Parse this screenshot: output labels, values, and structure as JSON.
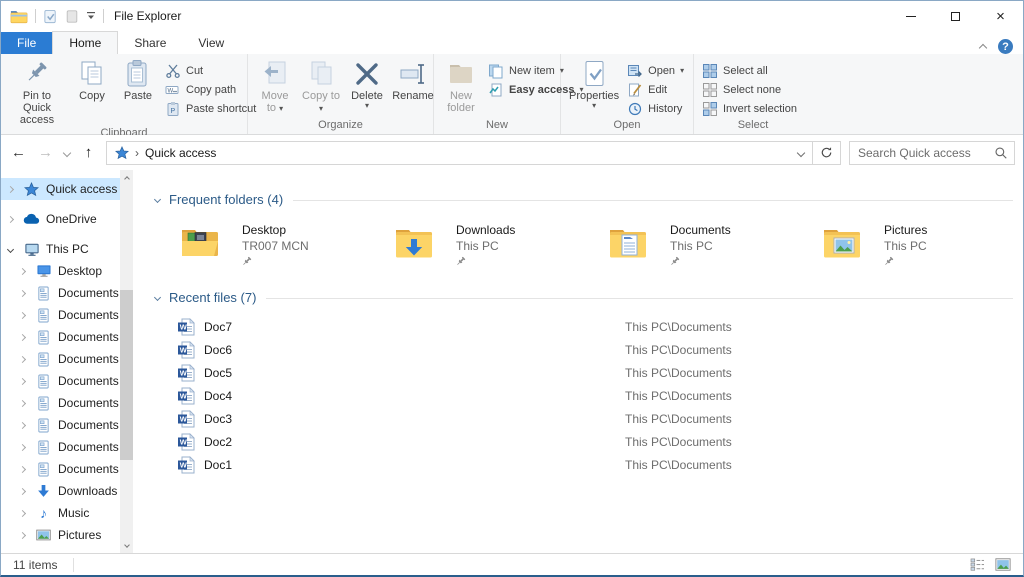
{
  "titlebar": {
    "title": "File Explorer"
  },
  "tabs": {
    "file": "File",
    "home": "Home",
    "share": "Share",
    "view": "View"
  },
  "ribbon": {
    "clipboard": {
      "label": "Clipboard",
      "pin_to_quick_access": "Pin to Quick access",
      "copy": "Copy",
      "paste": "Paste",
      "cut": "Cut",
      "copy_path": "Copy path",
      "paste_shortcut": "Paste shortcut"
    },
    "organize": {
      "label": "Organize",
      "move_to": "Move to",
      "copy_to": "Copy to",
      "delete": "Delete",
      "rename": "Rename"
    },
    "new": {
      "label": "New",
      "new_folder": "New folder",
      "new_item": "New item",
      "easy_access": "Easy access"
    },
    "open": {
      "label": "Open",
      "properties": "Properties",
      "open": "Open",
      "edit": "Edit",
      "history": "History"
    },
    "select": {
      "label": "Select",
      "select_all": "Select all",
      "select_none": "Select none",
      "invert_selection": "Invert selection"
    }
  },
  "address_bar": {
    "location": "Quick access",
    "search_placeholder": "Search Quick access"
  },
  "sidebar": {
    "items": [
      {
        "label": "Quick access",
        "icon": "star",
        "chevron": "right",
        "level": 0,
        "selected": true
      },
      {
        "label": "OneDrive",
        "icon": "cloud",
        "chevron": "right",
        "level": 0,
        "gap": true
      },
      {
        "label": "This PC",
        "icon": "pc",
        "chevron": "down",
        "level": 0,
        "gap": true
      },
      {
        "label": "Desktop",
        "icon": "monitor",
        "chevron": "right",
        "level": 1
      },
      {
        "label": "Documents",
        "icon": "document",
        "chevron": "right",
        "level": 1
      },
      {
        "label": "Documents",
        "icon": "document",
        "chevron": "right",
        "level": 1
      },
      {
        "label": "Documents",
        "icon": "document",
        "chevron": "right",
        "level": 1
      },
      {
        "label": "Documents",
        "icon": "document",
        "chevron": "right",
        "level": 1
      },
      {
        "label": "Documents",
        "icon": "document",
        "chevron": "right",
        "level": 1
      },
      {
        "label": "Documents",
        "icon": "document",
        "chevron": "right",
        "level": 1
      },
      {
        "label": "Documents",
        "icon": "document",
        "chevron": "right",
        "level": 1
      },
      {
        "label": "Documents",
        "icon": "document",
        "chevron": "right",
        "level": 1
      },
      {
        "label": "Documents",
        "icon": "document",
        "chevron": "right",
        "level": 1
      },
      {
        "label": "Downloads",
        "icon": "download",
        "chevron": "right",
        "level": 1
      },
      {
        "label": "Music",
        "icon": "music",
        "chevron": "right",
        "level": 1
      },
      {
        "label": "Pictures",
        "icon": "picture",
        "chevron": "right",
        "level": 1
      }
    ]
  },
  "content": {
    "frequent": {
      "title": "Frequent folders (4)",
      "tiles": [
        {
          "name": "Desktop",
          "location": "TR007 MCN",
          "icon": "folder-desktop",
          "pinned": true
        },
        {
          "name": "Downloads",
          "location": "This PC",
          "icon": "folder-downloads",
          "pinned": true
        },
        {
          "name": "Documents",
          "location": "This PC",
          "icon": "folder-documents",
          "pinned": true
        },
        {
          "name": "Pictures",
          "location": "This PC",
          "icon": "folder-pictures",
          "pinned": true
        }
      ]
    },
    "recent": {
      "title": "Recent files (7)",
      "files": [
        {
          "name": "Doc7",
          "path": "This PC\\Documents",
          "icon": "word"
        },
        {
          "name": "Doc6",
          "path": "This PC\\Documents",
          "icon": "word"
        },
        {
          "name": "Doc5",
          "path": "This PC\\Documents",
          "icon": "word"
        },
        {
          "name": "Doc4",
          "path": "This PC\\Documents",
          "icon": "word"
        },
        {
          "name": "Doc3",
          "path": "This PC\\Documents",
          "icon": "word"
        },
        {
          "name": "Doc2",
          "path": "This PC\\Documents",
          "icon": "word"
        },
        {
          "name": "Doc1",
          "path": "This PC\\Documents",
          "icon": "word"
        }
      ]
    }
  },
  "status_bar": {
    "items_count": "11 items"
  }
}
